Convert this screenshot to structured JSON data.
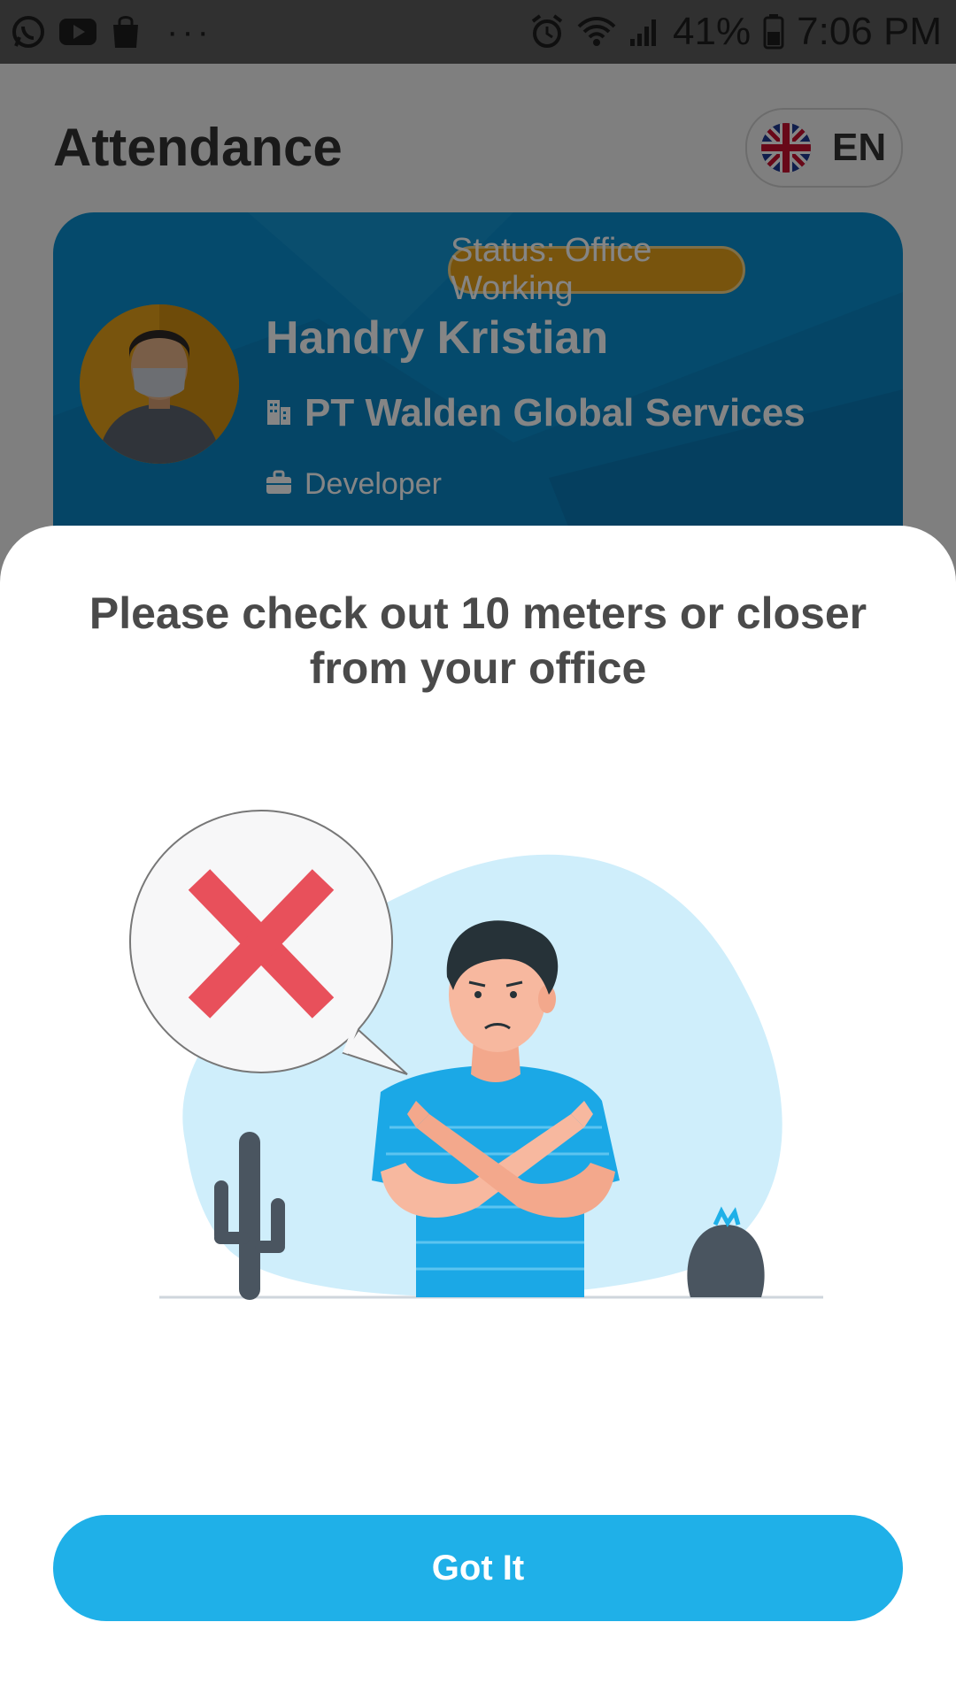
{
  "status_bar": {
    "left_icons": [
      "whatsapp-icon",
      "youtube-icon",
      "shopping-bag-icon",
      "more-dots-icon"
    ],
    "more_dots": "···",
    "battery_percent": "41%",
    "time": "7:06 PM"
  },
  "header": {
    "title": "Attendance",
    "language": "EN"
  },
  "profile": {
    "status": "Status: Office Working",
    "name": "Handry Kristian",
    "company": "PT Walden Global Services",
    "role": "Developer"
  },
  "dialog": {
    "message": "Please check out 10 meters or closer from your office",
    "button_label": "Got It"
  },
  "colors": {
    "accent": "#1fb0e8",
    "card": "#0a8fcf",
    "badge": "#e6a21a",
    "error_x": "#e8505b"
  }
}
